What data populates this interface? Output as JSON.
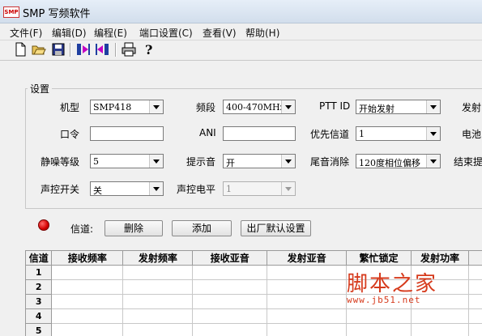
{
  "window": {
    "title": "SMP 写频软件",
    "logo_text": "SMP"
  },
  "menu": [
    "文件(F)",
    "编辑(D)",
    "编程(E)",
    "端口设置(C)",
    "查看(V)",
    "帮助(H)"
  ],
  "toolbar": {
    "buttons": [
      "new-file-icon",
      "open-folder-icon",
      "save-icon",
      "read-from-radio-icon",
      "write-to-radio-icon",
      "print-icon",
      "help-icon"
    ]
  },
  "settings": {
    "title": "设置",
    "model": {
      "label": "机型",
      "value": "SMP418"
    },
    "band": {
      "label": "频段",
      "value": "400-470MHz"
    },
    "ptt_id": {
      "label": "PTT ID",
      "value": "开始发射"
    },
    "tx_cut": {
      "label": "发射"
    },
    "password": {
      "label": "口令",
      "value": ""
    },
    "ani": {
      "label": "ANI",
      "value": ""
    },
    "priority_channel": {
      "label": "优先信道",
      "value": "1"
    },
    "battery_cut": {
      "label": "电池"
    },
    "squelch": {
      "label": "静噪等级",
      "value": "5"
    },
    "beep": {
      "label": "提示音",
      "value": "开"
    },
    "tail_elim": {
      "label": "尾音消除",
      "value": "120度相位偏移"
    },
    "end_tone_cut": {
      "label": "结束提"
    },
    "vox": {
      "label": "声控开关",
      "value": "关"
    },
    "vox_level": {
      "label": "声控电平",
      "value": "1"
    }
  },
  "channels": {
    "label": "信道:",
    "delete_button": "删除",
    "add_button": "添加",
    "reset_button": "出厂默认设置",
    "led_color": "#d40000",
    "headers": [
      "信道",
      "接收频率",
      "发射频率",
      "接收亚音",
      "发射亚音",
      "繁忙锁定",
      "发射功率"
    ],
    "rows": [
      "1",
      "2",
      "3",
      "4",
      "5"
    ]
  },
  "watermark": {
    "text": "脚本之家",
    "url": "www.jb51.net"
  }
}
